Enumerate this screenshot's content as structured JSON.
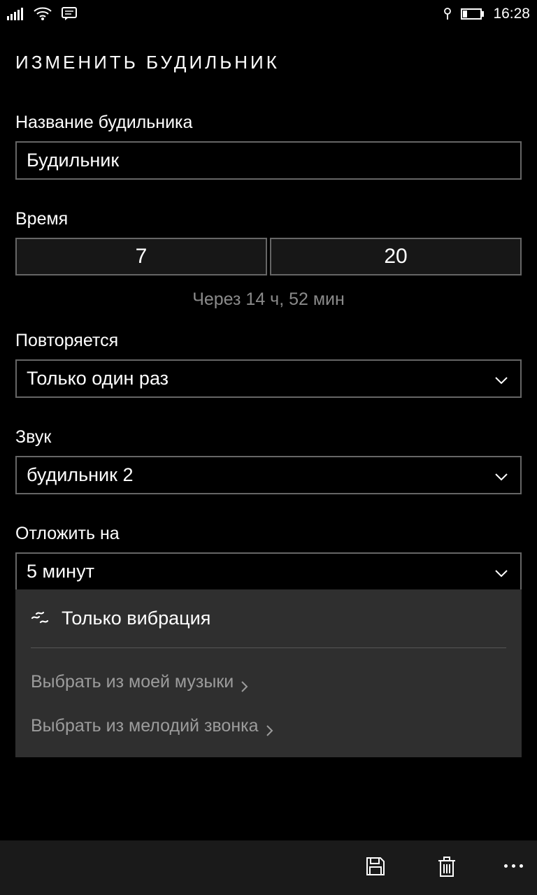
{
  "statusbar": {
    "time": "16:28"
  },
  "page": {
    "title": "ИЗМЕНИТЬ БУДИЛЬНИК"
  },
  "alarm_name": {
    "label": "Название будильника",
    "value": "Будильник"
  },
  "time": {
    "label": "Время",
    "hour": "7",
    "minute": "20",
    "note": "Через 14 ч, 52 мин"
  },
  "repeat": {
    "label": "Повторяется",
    "value": "Только один раз"
  },
  "sound": {
    "label": "Звук",
    "value": "будильник 2"
  },
  "snooze": {
    "label": "Отложить на",
    "value": "5 минут"
  },
  "panel": {
    "vibration_only": "Только вибрация",
    "pick_music": "Выбрать из моей музыки",
    "pick_ringtone": "Выбрать из мелодий звонка"
  }
}
